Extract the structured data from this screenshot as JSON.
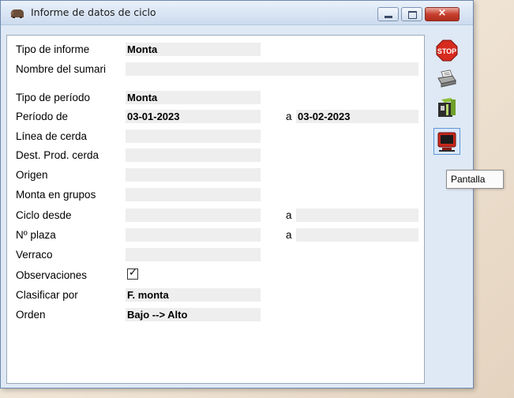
{
  "window": {
    "title": "Informe de datos de ciclo",
    "close_glyph": "×"
  },
  "form": {
    "tipo_informe": {
      "label": "Tipo de informe",
      "value": "Monta"
    },
    "nombre_sumario": {
      "label": "Nombre del sumari",
      "value": ""
    },
    "tipo_periodo": {
      "label": "Tipo de período",
      "value": "Monta"
    },
    "periodo": {
      "label": "Período de",
      "from": "03-01-2023",
      "a": "a",
      "to": "03-02-2023"
    },
    "linea_cerda": {
      "label": "Línea de cerda",
      "value": ""
    },
    "dest_prod_cerda": {
      "label": "Dest. Prod. cerda",
      "value": ""
    },
    "origen": {
      "label": "Origen",
      "value": ""
    },
    "monta_grupos": {
      "label": "Monta en grupos",
      "value": ""
    },
    "ciclo": {
      "label": "Ciclo desde",
      "from": "",
      "a": "a",
      "to": ""
    },
    "plaza": {
      "label": "Nº plaza",
      "from": "",
      "a": "a",
      "to": ""
    },
    "verraco": {
      "label": "Verraco",
      "value": ""
    },
    "observaciones": {
      "label": "Observaciones",
      "checked": true,
      "check_glyph": "✓"
    },
    "clasificar": {
      "label": "Clasificar por",
      "value": "F. monta"
    },
    "orden": {
      "label": "Orden",
      "value": "Bajo --> Alto"
    }
  },
  "toolbar": {
    "stop_label": "STOP",
    "buttons": [
      "stop-icon",
      "printer-icon",
      "export-icon",
      "monitor-icon"
    ],
    "tooltip": "Pantalla"
  }
}
